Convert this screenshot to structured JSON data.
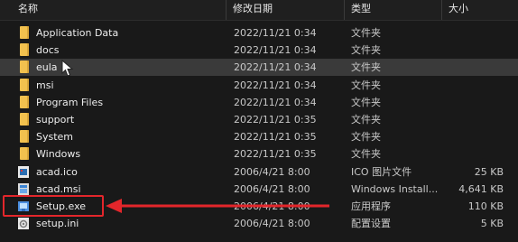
{
  "header": {
    "name": "名称",
    "date": "修改日期",
    "type": "类型",
    "size": "大小"
  },
  "colors": {
    "background": "#191919",
    "hover_row": "#3a3a3a",
    "folder": "#f2c14e",
    "annotation": "#e3262b"
  },
  "files": [
    {
      "name": "Application Data",
      "date": "2022/11/21 0:34",
      "type": "文件夹",
      "size": "",
      "icon": "folder-icon"
    },
    {
      "name": "docs",
      "date": "2022/11/21 0:34",
      "type": "文件夹",
      "size": "",
      "icon": "folder-icon"
    },
    {
      "name": "eula",
      "date": "2022/11/21 0:34",
      "type": "文件夹",
      "size": "",
      "icon": "folder-icon",
      "hovered": true
    },
    {
      "name": "msi",
      "date": "2022/11/21 0:34",
      "type": "文件夹",
      "size": "",
      "icon": "folder-icon"
    },
    {
      "name": "Program Files",
      "date": "2022/11/21 0:34",
      "type": "文件夹",
      "size": "",
      "icon": "folder-icon"
    },
    {
      "name": "support",
      "date": "2022/11/21 0:35",
      "type": "文件夹",
      "size": "",
      "icon": "folder-icon"
    },
    {
      "name": "System",
      "date": "2022/11/21 0:35",
      "type": "文件夹",
      "size": "",
      "icon": "folder-icon"
    },
    {
      "name": "Windows",
      "date": "2022/11/21 0:35",
      "type": "文件夹",
      "size": "",
      "icon": "folder-icon"
    },
    {
      "name": "acad.ico",
      "date": "2006/4/21 8:00",
      "type": "ICO 图片文件",
      "size": "25 KB",
      "icon": "ico-file-icon"
    },
    {
      "name": "acad.msi",
      "date": "2006/4/21 8:00",
      "type": "Windows Install...",
      "size": "4,641 KB",
      "icon": "msi-file-icon"
    },
    {
      "name": "Setup.exe",
      "date": "2006/4/21 8:00",
      "type": "应用程序",
      "size": "110 KB",
      "icon": "setup-exe-icon",
      "annotated": true
    },
    {
      "name": "setup.ini",
      "date": "2006/4/21 8:00",
      "type": "配置设置",
      "size": "5 KB",
      "icon": "ini-file-icon"
    }
  ]
}
